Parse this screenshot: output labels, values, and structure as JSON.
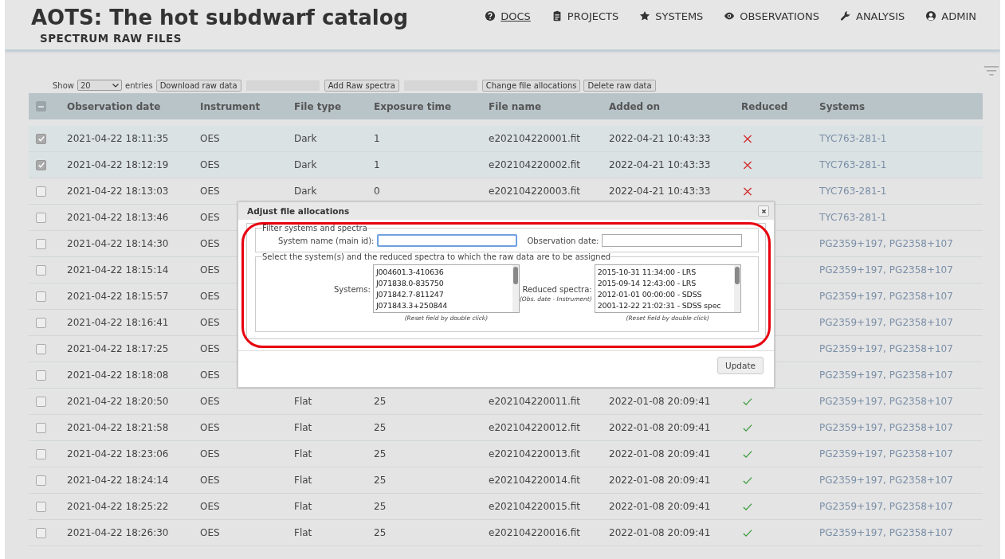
{
  "header": {
    "title": "AOTS: The hot subdwarf catalog",
    "subtitle": "SPECTRUM RAW FILES",
    "nav": [
      {
        "label": "DOCS",
        "selected": true
      },
      {
        "label": "PROJECTS",
        "selected": false
      },
      {
        "label": "SYSTEMS",
        "selected": false
      },
      {
        "label": "OBSERVATIONS",
        "selected": false
      },
      {
        "label": "ANALYSIS",
        "selected": false
      },
      {
        "label": "ADMIN",
        "selected": false
      }
    ]
  },
  "toolbar": {
    "show_label": "Show",
    "page_size": "20",
    "entries_label": "entries",
    "buttons": [
      {
        "kind": "button",
        "label": "Download raw data"
      },
      {
        "kind": "blank"
      },
      {
        "kind": "button",
        "label": "Add Raw spectra"
      },
      {
        "kind": "blank"
      },
      {
        "kind": "button",
        "label": "Change file allocations"
      },
      {
        "kind": "button",
        "label": "Delete raw data"
      }
    ]
  },
  "table": {
    "select_all_partial": true,
    "columns": [
      "Observation date",
      "Instrument",
      "File type",
      "Exposure time",
      "File name",
      "Added on",
      "Reduced",
      "Systems"
    ],
    "rows": [
      {
        "checked": true,
        "date": "2021-04-22 18:11:35",
        "instrument": "OES",
        "file_type": "Dark",
        "exposure": "1",
        "file_name": "e202104220001.fit",
        "added": "2022-04-21 10:43:33",
        "reduced": false,
        "systems": [
          "TYC763-281-1"
        ]
      },
      {
        "checked": true,
        "date": "2021-04-22 18:12:19",
        "instrument": "OES",
        "file_type": "Dark",
        "exposure": "1",
        "file_name": "e202104220002.fit",
        "added": "2022-04-21 10:43:33",
        "reduced": false,
        "systems": [
          "TYC763-281-1"
        ]
      },
      {
        "checked": false,
        "date": "2021-04-22 18:13:03",
        "instrument": "OES",
        "file_type": "Dark",
        "exposure": "0",
        "file_name": "e202104220003.fit",
        "added": "2022-04-21 10:43:33",
        "reduced": false,
        "systems": [
          "TYC763-281-1"
        ]
      },
      {
        "checked": false,
        "date": "2021-04-22 18:13:46",
        "instrument": "OES",
        "systems": [
          "TYC763-281-1"
        ]
      },
      {
        "checked": false,
        "date": "2021-04-22 18:14:30",
        "instrument": "OES",
        "systems": [
          "PG2359+197,",
          "PG2358+107"
        ]
      },
      {
        "checked": false,
        "date": "2021-04-22 18:15:14",
        "instrument": "OES",
        "systems": [
          "PG2359+197,",
          "PG2358+107"
        ]
      },
      {
        "checked": false,
        "date": "2021-04-22 18:15:57",
        "instrument": "OES",
        "systems": [
          "PG2359+197,",
          "PG2358+107"
        ]
      },
      {
        "checked": false,
        "date": "2021-04-22 18:16:41",
        "instrument": "OES",
        "systems": [
          "PG2359+197,",
          "PG2358+107"
        ]
      },
      {
        "checked": false,
        "date": "2021-04-22 18:17:25",
        "instrument": "OES",
        "systems": [
          "PG2359+197,",
          "PG2358+107"
        ]
      },
      {
        "checked": false,
        "date": "2021-04-22 18:18:08",
        "instrument": "OES",
        "systems": [
          "PG2359+197,",
          "PG2358+107"
        ]
      },
      {
        "checked": false,
        "date": "2021-04-22 18:20:50",
        "instrument": "OES",
        "file_type": "Flat",
        "exposure": "25",
        "file_name": "e202104220011.fit",
        "added": "2022-01-08 20:09:41",
        "reduced": true,
        "systems": [
          "PG2359+197,",
          "PG2358+107"
        ]
      },
      {
        "checked": false,
        "date": "2021-04-22 18:21:58",
        "instrument": "OES",
        "file_type": "Flat",
        "exposure": "25",
        "file_name": "e202104220012.fit",
        "added": "2022-01-08 20:09:41",
        "reduced": true,
        "systems": [
          "PG2359+197,",
          "PG2358+107"
        ]
      },
      {
        "checked": false,
        "date": "2021-04-22 18:23:06",
        "instrument": "OES",
        "file_type": "Flat",
        "exposure": "25",
        "file_name": "e202104220013.fit",
        "added": "2022-01-08 20:09:41",
        "reduced": true,
        "systems": [
          "PG2359+197,",
          "PG2358+107"
        ]
      },
      {
        "checked": false,
        "date": "2021-04-22 18:24:14",
        "instrument": "OES",
        "file_type": "Flat",
        "exposure": "25",
        "file_name": "e202104220014.fit",
        "added": "2022-01-08 20:09:41",
        "reduced": true,
        "systems": [
          "PG2359+197,",
          "PG2358+107"
        ]
      },
      {
        "checked": false,
        "date": "2021-04-22 18:25:22",
        "instrument": "OES",
        "file_type": "Flat",
        "exposure": "25",
        "file_name": "e202104220015.fit",
        "added": "2022-01-08 20:09:41",
        "reduced": true,
        "systems": [
          "PG2359+197,",
          "PG2358+107"
        ]
      },
      {
        "checked": false,
        "date": "2021-04-22 18:26:30",
        "instrument": "OES",
        "file_type": "Flat",
        "exposure": "25",
        "file_name": "e202104220016.fit",
        "added": "2022-01-08 20:09:41",
        "reduced": true,
        "systems": [
          "PG2359+197,",
          "PG2358+107"
        ]
      }
    ]
  },
  "dialog": {
    "title": "Adjust file allocations",
    "filter": {
      "legend": "Filter systems and spectra",
      "name_label": "System name (main id):",
      "date_label": "Observation date:"
    },
    "select": {
      "legend": "Select the system(s) and the reduced spectra to which the raw data are to be assigned",
      "systems_label": "Systems:",
      "systems": [
        "J004601.3-410636",
        "J071838.0-835750",
        "J071842.7-811247",
        "J071843.3+250844"
      ],
      "systems_hint": "(Reset field by double click)",
      "spectra_label": "Reduced spectra:",
      "spectra_sublabel": "(Obs. date - Instrument)",
      "spectra": [
        "2015-10-31 11:34:00 - LRS",
        "2015-09-14 12:43:00 - LRS",
        "2012-01-01 00:00:00 - SDSS",
        "2001-12-22 21:02:31 - SDSS spec"
      ],
      "spectra_hint": "(Reset field by double click)"
    },
    "update_button": "Update"
  }
}
